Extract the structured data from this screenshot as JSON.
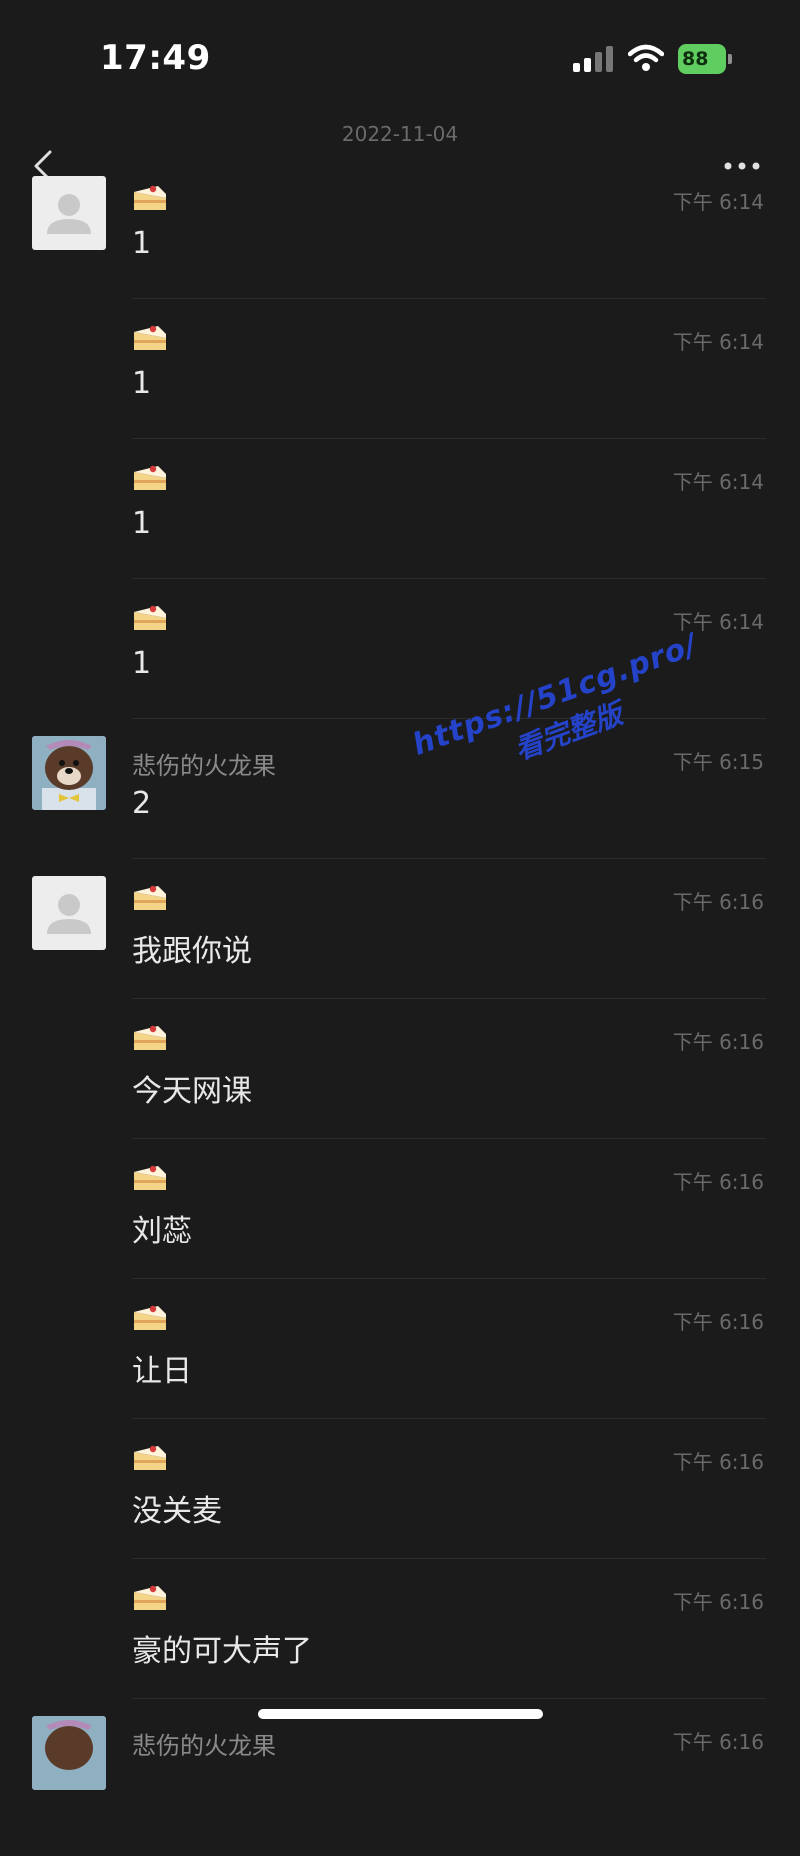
{
  "status_bar": {
    "time": "17:49",
    "battery": "88"
  },
  "date_header": "2022-11-04",
  "colors": {
    "background": "#1b1b1b",
    "battery": "#5fcd5f",
    "watermark": "#2443c9"
  },
  "messages": [
    {
      "sender": "🍰",
      "avatar": "default",
      "time": "下午 6:14",
      "text": "1"
    },
    {
      "sender": "🍰",
      "avatar": "none",
      "time": "下午 6:14",
      "text": "1"
    },
    {
      "sender": "🍰",
      "avatar": "none",
      "time": "下午 6:14",
      "text": "1"
    },
    {
      "sender": "🍰",
      "avatar": "none",
      "time": "下午 6:14",
      "text": "1"
    },
    {
      "sender": "悲伤的火龙果",
      "avatar": "bear",
      "time": "下午 6:15",
      "text": "2"
    },
    {
      "sender": "🍰",
      "avatar": "default",
      "time": "下午 6:16",
      "text": "我跟你说"
    },
    {
      "sender": "🍰",
      "avatar": "none",
      "time": "下午 6:16",
      "text": "今天网课"
    },
    {
      "sender": "🍰",
      "avatar": "none",
      "time": "下午 6:16",
      "text": "刘蕊"
    },
    {
      "sender": "🍰",
      "avatar": "none",
      "time": "下午 6:16",
      "text": "让日"
    },
    {
      "sender": "🍰",
      "avatar": "none",
      "time": "下午 6:16",
      "text": "没关麦"
    },
    {
      "sender": "🍰",
      "avatar": "none",
      "time": "下午 6:16",
      "text": "豪的可大声了"
    },
    {
      "sender": "悲伤的火龙果",
      "avatar": "bear",
      "time": "下午 6:16",
      "text": ""
    }
  ],
  "watermark": {
    "line1": "https://51cg.pro/",
    "line2": "看完整版"
  },
  "icons": {
    "back": "chevron-left-icon",
    "more": "more-dots-icon",
    "signal": "signal-icon",
    "wifi": "wifi-icon",
    "battery": "battery-icon"
  }
}
